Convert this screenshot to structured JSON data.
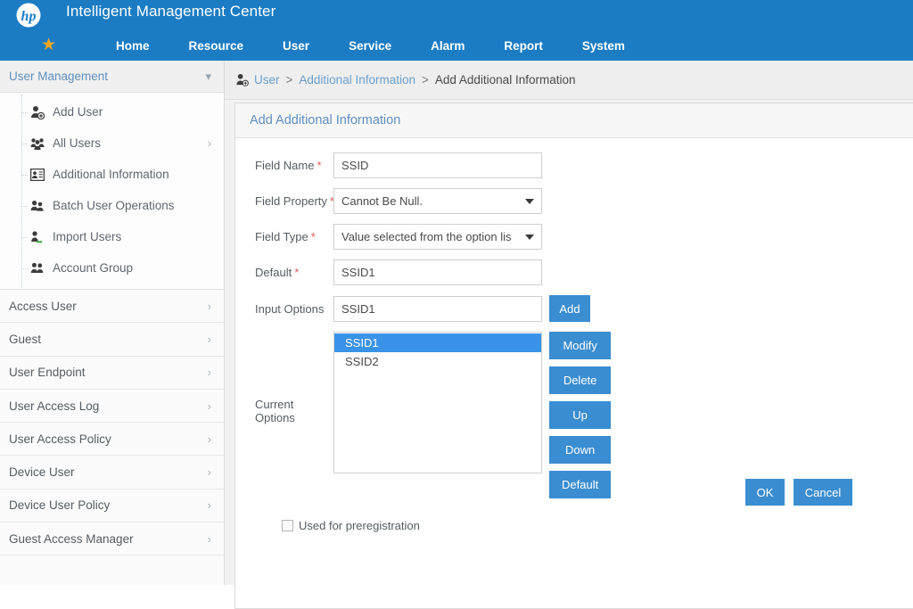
{
  "header": {
    "logo_icon": "hp-logo-icon",
    "app_title": "Intelligent Management Center",
    "favorite_icon": "star-icon",
    "nav_items": [
      {
        "label": "Home"
      },
      {
        "label": "Resource"
      },
      {
        "label": "User"
      },
      {
        "label": "Service"
      },
      {
        "label": "Alarm"
      },
      {
        "label": "Report"
      },
      {
        "label": "System"
      }
    ]
  },
  "sidebar": {
    "section_title": "User Management",
    "collapse_icon": "chevron-down-icon",
    "tree_items": [
      {
        "label": "Add User",
        "icon": "add-user-icon",
        "has_chevron": false
      },
      {
        "label": "All Users",
        "icon": "all-users-icon",
        "has_chevron": true
      },
      {
        "label": "Additional Information",
        "icon": "id-card-icon",
        "has_chevron": false
      },
      {
        "label": "Batch User Operations",
        "icon": "batch-users-icon",
        "has_chevron": false
      },
      {
        "label": "Import Users",
        "icon": "import-users-icon",
        "has_chevron": false
      },
      {
        "label": "Account Group",
        "icon": "account-group-icon",
        "has_chevron": false
      }
    ],
    "flat_items": [
      {
        "label": "Access User"
      },
      {
        "label": "Guest"
      },
      {
        "label": "User Endpoint"
      },
      {
        "label": "User Access Log"
      },
      {
        "label": "User Access Policy"
      },
      {
        "label": "Device User"
      },
      {
        "label": "Device User Policy"
      },
      {
        "label": "Guest Access Manager"
      }
    ],
    "chevron_icon": "chevron-right-icon"
  },
  "breadcrumb": {
    "icon": "user-breadcrumb-icon",
    "link1": "User",
    "sep1": ">",
    "link2": "Additional Information",
    "sep2": ">",
    "current": "Add Additional Information"
  },
  "card": {
    "title": "Add Additional Information"
  },
  "form": {
    "field_name": {
      "label": "Field Name",
      "required": "*",
      "value": "SSID",
      "placeholder": ""
    },
    "field_property": {
      "label": "Field Property",
      "required": "*",
      "value": "Cannot Be Null.",
      "options": [
        "Cannot Be Null."
      ]
    },
    "field_type": {
      "label": "Field Type",
      "required": "*",
      "value": "Value selected from the option lis",
      "options": [
        "Value selected from the option lis"
      ]
    },
    "default": {
      "label": "Default",
      "required": "*",
      "value": "SSID1",
      "placeholder": ""
    },
    "input_options": {
      "label": "Input Options",
      "value": "SSID1",
      "placeholder": "",
      "add_label": "Add"
    },
    "current_options": {
      "label": "Current Options",
      "items": [
        {
          "value": "SSID1",
          "selected": true
        },
        {
          "value": "SSID2",
          "selected": false
        }
      ],
      "buttons": [
        {
          "label": "Modify"
        },
        {
          "label": "Delete"
        },
        {
          "label": "Up"
        },
        {
          "label": "Down"
        },
        {
          "label": "Default"
        }
      ]
    },
    "preregistration": {
      "label": "Used for preregistration",
      "checked": false
    }
  },
  "actions": {
    "ok_label": "OK",
    "cancel_label": "Cancel"
  },
  "colors": {
    "header_blue": "#1b7cc4",
    "button_blue": "#3a8dd0",
    "selection_blue": "#3a93e8",
    "link_blue": "#5f8fc0",
    "required_red": "#e05c5c",
    "star_orange": "#f5a623"
  }
}
